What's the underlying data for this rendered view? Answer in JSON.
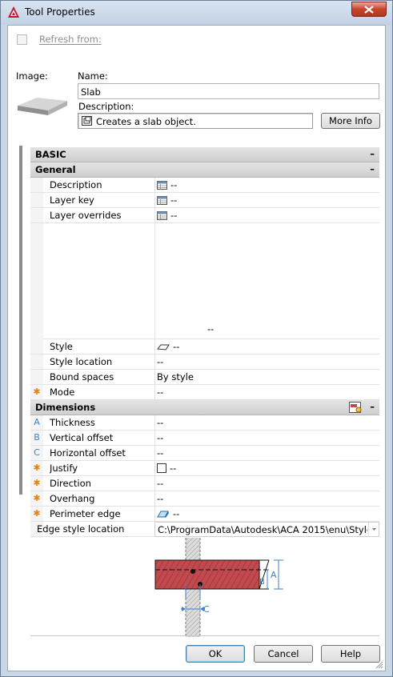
{
  "window": {
    "title": "Tool Properties"
  },
  "refresh": {
    "label": "Refresh from:",
    "checked": false
  },
  "image": {
    "label": "Image:"
  },
  "name": {
    "label": "Name:",
    "value": "Slab"
  },
  "description": {
    "label": "Description:",
    "value": "Creates a slab object."
  },
  "more_info": {
    "label": "More Info"
  },
  "categories": {
    "basic": {
      "label": "BASIC"
    },
    "general": {
      "label": "General"
    },
    "dimensions": {
      "label": "Dimensions"
    }
  },
  "general_rows": [
    {
      "name": "Description",
      "value": "--",
      "icon": "table-icon"
    },
    {
      "name": "Layer key",
      "value": "--",
      "icon": "table-icon"
    },
    {
      "name": "Layer overrides",
      "value": "--",
      "icon": "table-icon"
    }
  ],
  "general_big_value": "--",
  "general_rows2": [
    {
      "name": "Style",
      "value": "--",
      "icon": "slab-style-icon"
    },
    {
      "name": "Style location",
      "value": "--"
    },
    {
      "name": "Bound spaces",
      "value": "By style"
    },
    {
      "name": "Mode",
      "value": "--",
      "mark": "✱"
    }
  ],
  "dimension_rows": [
    {
      "mark": "A",
      "name": "Thickness",
      "value": "--"
    },
    {
      "mark": "B",
      "name": "Vertical offset",
      "value": "--"
    },
    {
      "mark": "C",
      "name": "Horizontal offset",
      "value": "--"
    },
    {
      "mark": "✱",
      "name": "Justify",
      "value": "--",
      "icon": "square-icon"
    },
    {
      "mark": "✱",
      "name": "Direction",
      "value": "--"
    },
    {
      "mark": "✱",
      "name": "Overhang",
      "value": "--"
    },
    {
      "mark": "✱",
      "name": "Perimeter edge",
      "value": "--",
      "icon": "edge-icon"
    }
  ],
  "edge_style": {
    "name": "Edge style location",
    "value": "C:\\ProgramData\\Autodesk\\ACA 2015\\enu\\Styles\\Im..."
  },
  "diagram": {
    "label_a": "A",
    "label_b": "B",
    "label_c": "C"
  },
  "buttons": {
    "ok": "OK",
    "cancel": "Cancel",
    "help": "Help"
  },
  "colors": {
    "slab_fill": "#c14a4f",
    "dimension_blue": "#3a82cc",
    "required_star": "#e38415"
  }
}
